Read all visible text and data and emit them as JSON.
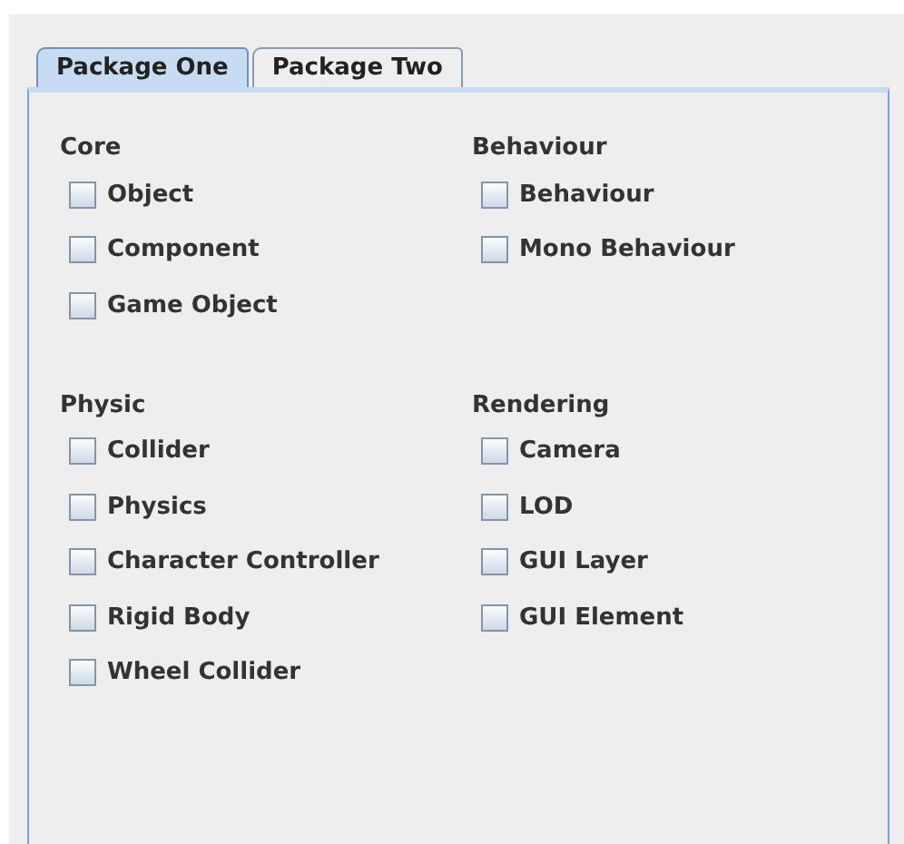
{
  "tabs": [
    {
      "label": "Package One",
      "selected": true
    },
    {
      "label": "Package Two",
      "selected": false
    }
  ],
  "sections": [
    {
      "title": "Core",
      "items": [
        {
          "label": "Object",
          "checked": false
        },
        {
          "label": "Component",
          "checked": false
        },
        {
          "label": "Game Object",
          "checked": false
        }
      ]
    },
    {
      "title": "Behaviour",
      "items": [
        {
          "label": "Behaviour",
          "checked": false
        },
        {
          "label": "Mono Behaviour",
          "checked": false
        }
      ]
    },
    {
      "title": "Physic",
      "items": [
        {
          "label": "Collider",
          "checked": false
        },
        {
          "label": "Physics",
          "checked": false
        },
        {
          "label": "Character Controller",
          "checked": false
        },
        {
          "label": "Rigid Body",
          "checked": false
        },
        {
          "label": "Wheel Collider",
          "checked": false
        }
      ]
    },
    {
      "title": "Rendering",
      "items": [
        {
          "label": "Camera",
          "checked": false
        },
        {
          "label": "LOD",
          "checked": false
        },
        {
          "label": "GUI Layer",
          "checked": false
        },
        {
          "label": "GUI Element",
          "checked": false
        }
      ]
    }
  ]
}
